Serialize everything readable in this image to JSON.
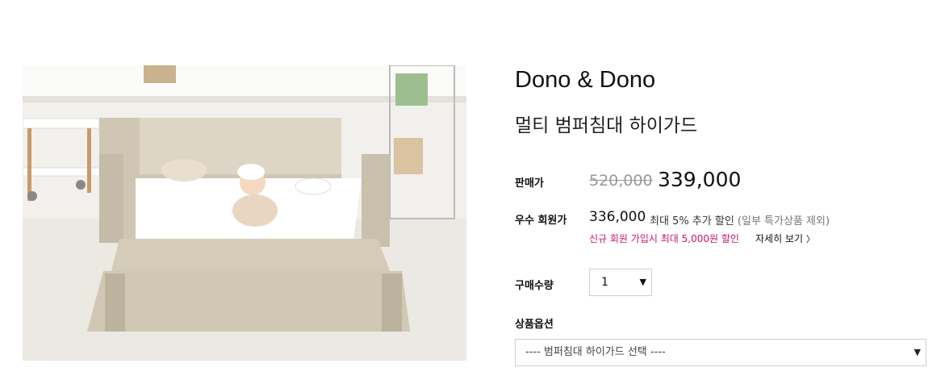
{
  "product": {
    "brand": "Dono & Dono",
    "name": "멀티 범퍼침대 하이가드",
    "image_alt": "product-photo"
  },
  "price": {
    "label": "판매가",
    "original": "520,000",
    "sale": "339,000"
  },
  "member": {
    "label": "우수 회원가",
    "price": "336,000",
    "desc": "최대 5% 추가 할인",
    "note": "(일부 특가상품 제외)",
    "signup_text": "신규 회원 가입시 최대 5,000원 할인",
    "more_label": "자세히 보기"
  },
  "quantity": {
    "label": "구매수량",
    "value": "1"
  },
  "option": {
    "label": "상품옵션",
    "placeholder": "---- 범퍼침대 하이가드 선택 ----"
  },
  "icons": [
    "chevron-right-icon",
    "chevron-down-icon"
  ]
}
